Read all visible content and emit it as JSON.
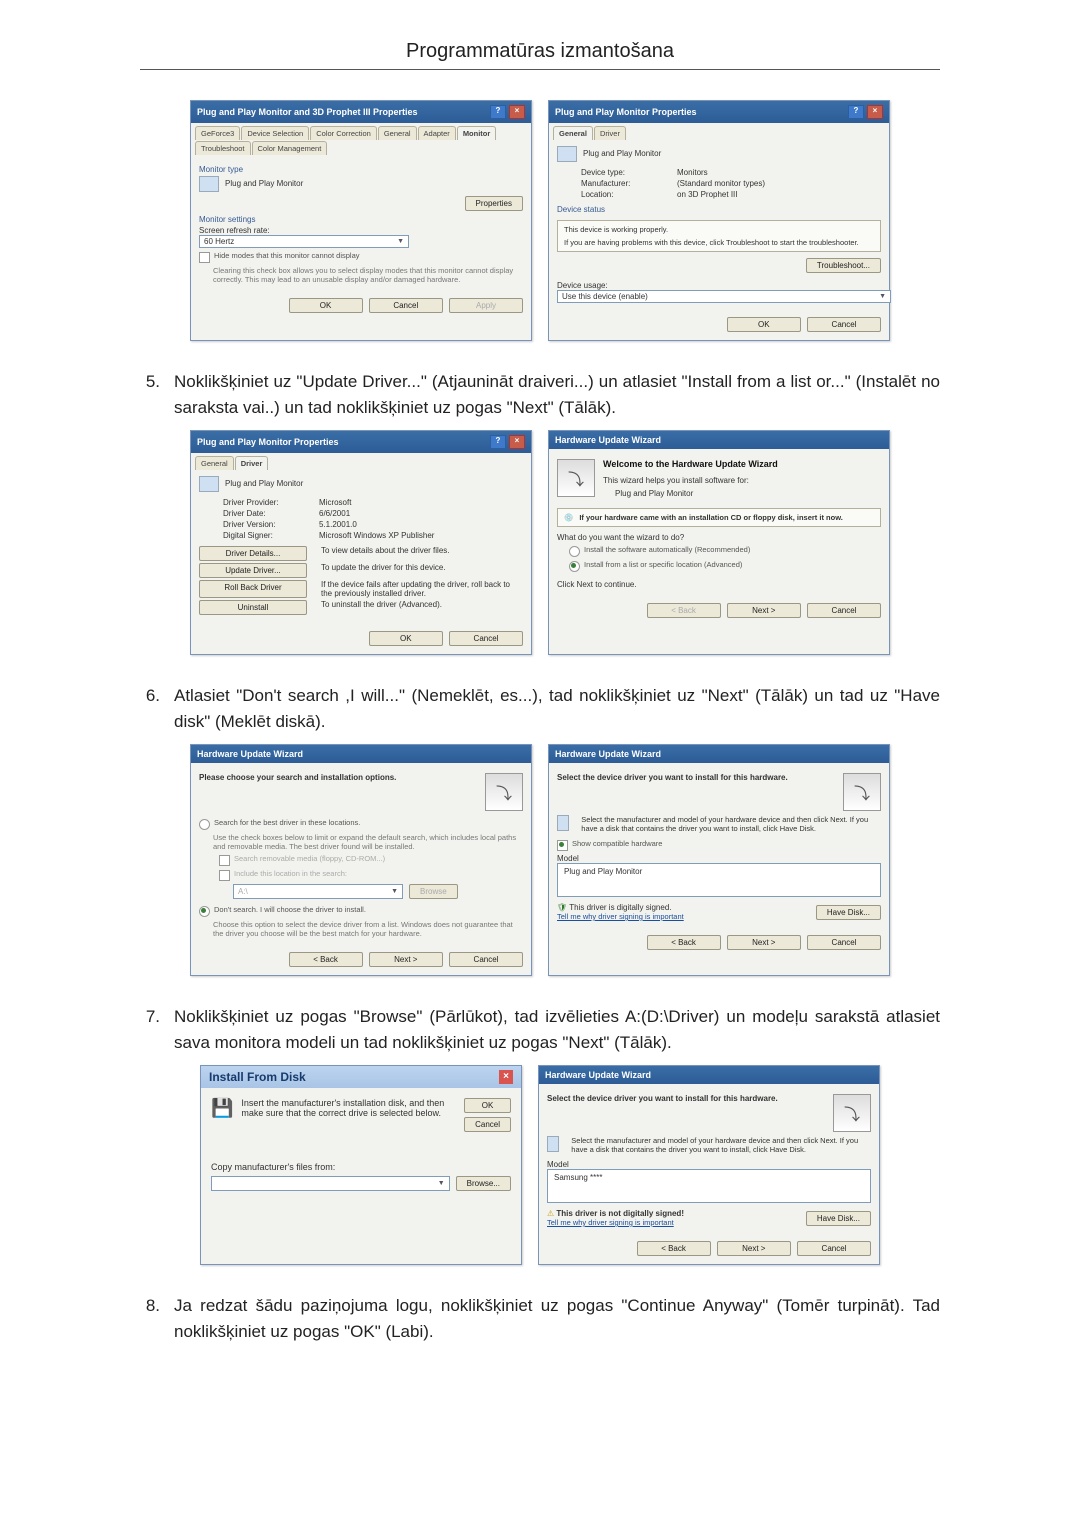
{
  "header": {
    "title": "Programmatūras izmantošana"
  },
  "step5": {
    "num": "5.",
    "text": "Noklikšķiniet uz \"Update Driver...\" (Atjaunināt draiveri...) un atlasiet \"Install from a list or...\" (Instalēt no saraksta vai..) un tad noklikšķiniet uz pogas \"Next\" (Tālāk)."
  },
  "step6": {
    "num": "6.",
    "text": "Atlasiet \"Don't search ,I will...\" (Nemeklēt, es...), tad noklikšķiniet uz \"Next\" (Tālāk) un tad uz \"Have disk\" (Meklēt diskā)."
  },
  "step7": {
    "num": "7.",
    "text": "Noklikšķiniet uz pogas \"Browse\" (Pārlūkot), tad izvēlieties A:(D:\\Driver) un modeļu sarakstā atlasiet sava monitora modeli un tad noklikšķiniet uz pogas \"Next\" (Tālāk)."
  },
  "step8": {
    "num": "8.",
    "text": "Ja redzat šādu paziņojuma logu, noklikšķiniet uz pogas \"Continue Anyway\" (Tomēr turpināt). Tad noklikšķiniet uz pogas \"OK\" (Labi)."
  },
  "winA": {
    "title": "Plug and Play Monitor and 3D Prophet III Properties",
    "tabs": [
      "GeForce3",
      "Device Selection",
      "Color Correction",
      "General",
      "Adapter",
      "Monitor",
      "Troubleshoot",
      "Color Management"
    ],
    "monitor_type_label": "Monitor type",
    "monitor_name": "Plug and Play Monitor",
    "properties_btn": "Properties",
    "settings_label": "Monitor settings",
    "refresh_label": "Screen refresh rate:",
    "refresh_value": "60 Hertz",
    "hide_check": "Hide modes that this monitor cannot display",
    "hide_desc": "Clearing this check box allows you to select display modes that this monitor cannot display correctly. This may lead to an unusable display and/or damaged hardware.",
    "ok": "OK",
    "cancel": "Cancel",
    "apply": "Apply"
  },
  "winB": {
    "title": "Plug and Play Monitor Properties",
    "tabs": [
      "General",
      "Driver"
    ],
    "device_name": "Plug and Play Monitor",
    "device_type_l": "Device type:",
    "device_type_v": "Monitors",
    "manuf_l": "Manufacturer:",
    "manuf_v": "(Standard monitor types)",
    "loc_l": "Location:",
    "loc_v": "on 3D Prophet III",
    "status_label": "Device status",
    "status_text": "This device is working properly.",
    "status_hint": "If you are having problems with this device, click Troubleshoot to start the troubleshooter.",
    "troubleshoot": "Troubleshoot...",
    "usage_label": "Device usage:",
    "usage_value": "Use this device (enable)",
    "ok": "OK",
    "cancel": "Cancel"
  },
  "winC": {
    "title": "Plug and Play Monitor Properties",
    "tabs": [
      "General",
      "Driver"
    ],
    "device_name": "Plug and Play Monitor",
    "prov_l": "Driver Provider:",
    "prov_v": "Microsoft",
    "date_l": "Driver Date:",
    "date_v": "6/6/2001",
    "ver_l": "Driver Version:",
    "ver_v": "5.1.2001.0",
    "sign_l": "Digital Signer:",
    "sign_v": "Microsoft Windows XP Publisher",
    "btn_details": "Driver Details...",
    "btn_details_d": "To view details about the driver files.",
    "btn_update": "Update Driver...",
    "btn_update_d": "To update the driver for this device.",
    "btn_roll": "Roll Back Driver",
    "btn_roll_d": "If the device fails after updating the driver, roll back to the previously installed driver.",
    "btn_uninst": "Uninstall",
    "btn_uninst_d": "To uninstall the driver (Advanced).",
    "ok": "OK",
    "cancel": "Cancel"
  },
  "winD": {
    "title": "Hardware Update Wizard",
    "welcome": "Welcome to the Hardware Update Wizard",
    "helps": "This wizard helps you install software for:",
    "device": "Plug and Play Monitor",
    "cd_hint": "If your hardware came with an installation CD or floppy disk, insert it now.",
    "what": "What do you want the wizard to do?",
    "opt1": "Install the software automatically (Recommended)",
    "opt2": "Install from a list or specific location (Advanced)",
    "cont": "Click Next to continue.",
    "back": "< Back",
    "next": "Next >",
    "cancel": "Cancel"
  },
  "winE": {
    "title": "Hardware Update Wizard",
    "head": "Please choose your search and installation options.",
    "opt1": "Search for the best driver in these locations.",
    "opt1d": "Use the check boxes below to limit or expand the default search, which includes local paths and removable media. The best driver found will be installed.",
    "chk1": "Search removable media (floppy, CD-ROM...)",
    "chk2": "Include this location in the search:",
    "path": "A:\\",
    "browse": "Browse",
    "opt2": "Don't search. I will choose the driver to install.",
    "opt2d": "Choose this option to select the device driver from a list. Windows does not guarantee that the driver you choose will be the best match for your hardware.",
    "back": "< Back",
    "next": "Next >",
    "cancel": "Cancel"
  },
  "winF": {
    "title": "Hardware Update Wizard",
    "head": "Select the device driver you want to install for this hardware.",
    "desc": "Select the manufacturer and model of your hardware device and then click Next. If you have a disk that contains the driver you want to install, click Have Disk.",
    "compat": "Show compatible hardware",
    "model_l": "Model",
    "model_v": "Plug and Play Monitor",
    "signed": "This driver is digitally signed.",
    "tell": "Tell me why driver signing is important",
    "have_disk": "Have Disk...",
    "back": "< Back",
    "next": "Next >",
    "cancel": "Cancel"
  },
  "winG": {
    "title": "Install From Disk",
    "msg": "Insert the manufacturer's installation disk, and then make sure that the correct drive is selected below.",
    "ok": "OK",
    "cancel": "Cancel",
    "copy": "Copy manufacturer's files from:",
    "browse": "Browse..."
  },
  "winH": {
    "title": "Hardware Update Wizard",
    "head": "Select the device driver you want to install for this hardware.",
    "desc": "Select the manufacturer and model of your hardware device and then click Next. If you have a disk that contains the driver you want to install, click Have Disk.",
    "model_l": "Model",
    "model_v": "Samsung ****",
    "warn": "This driver is not digitally signed!",
    "tell": "Tell me why driver signing is important",
    "have_disk": "Have Disk...",
    "back": "< Back",
    "next": "Next >",
    "cancel": "Cancel"
  }
}
